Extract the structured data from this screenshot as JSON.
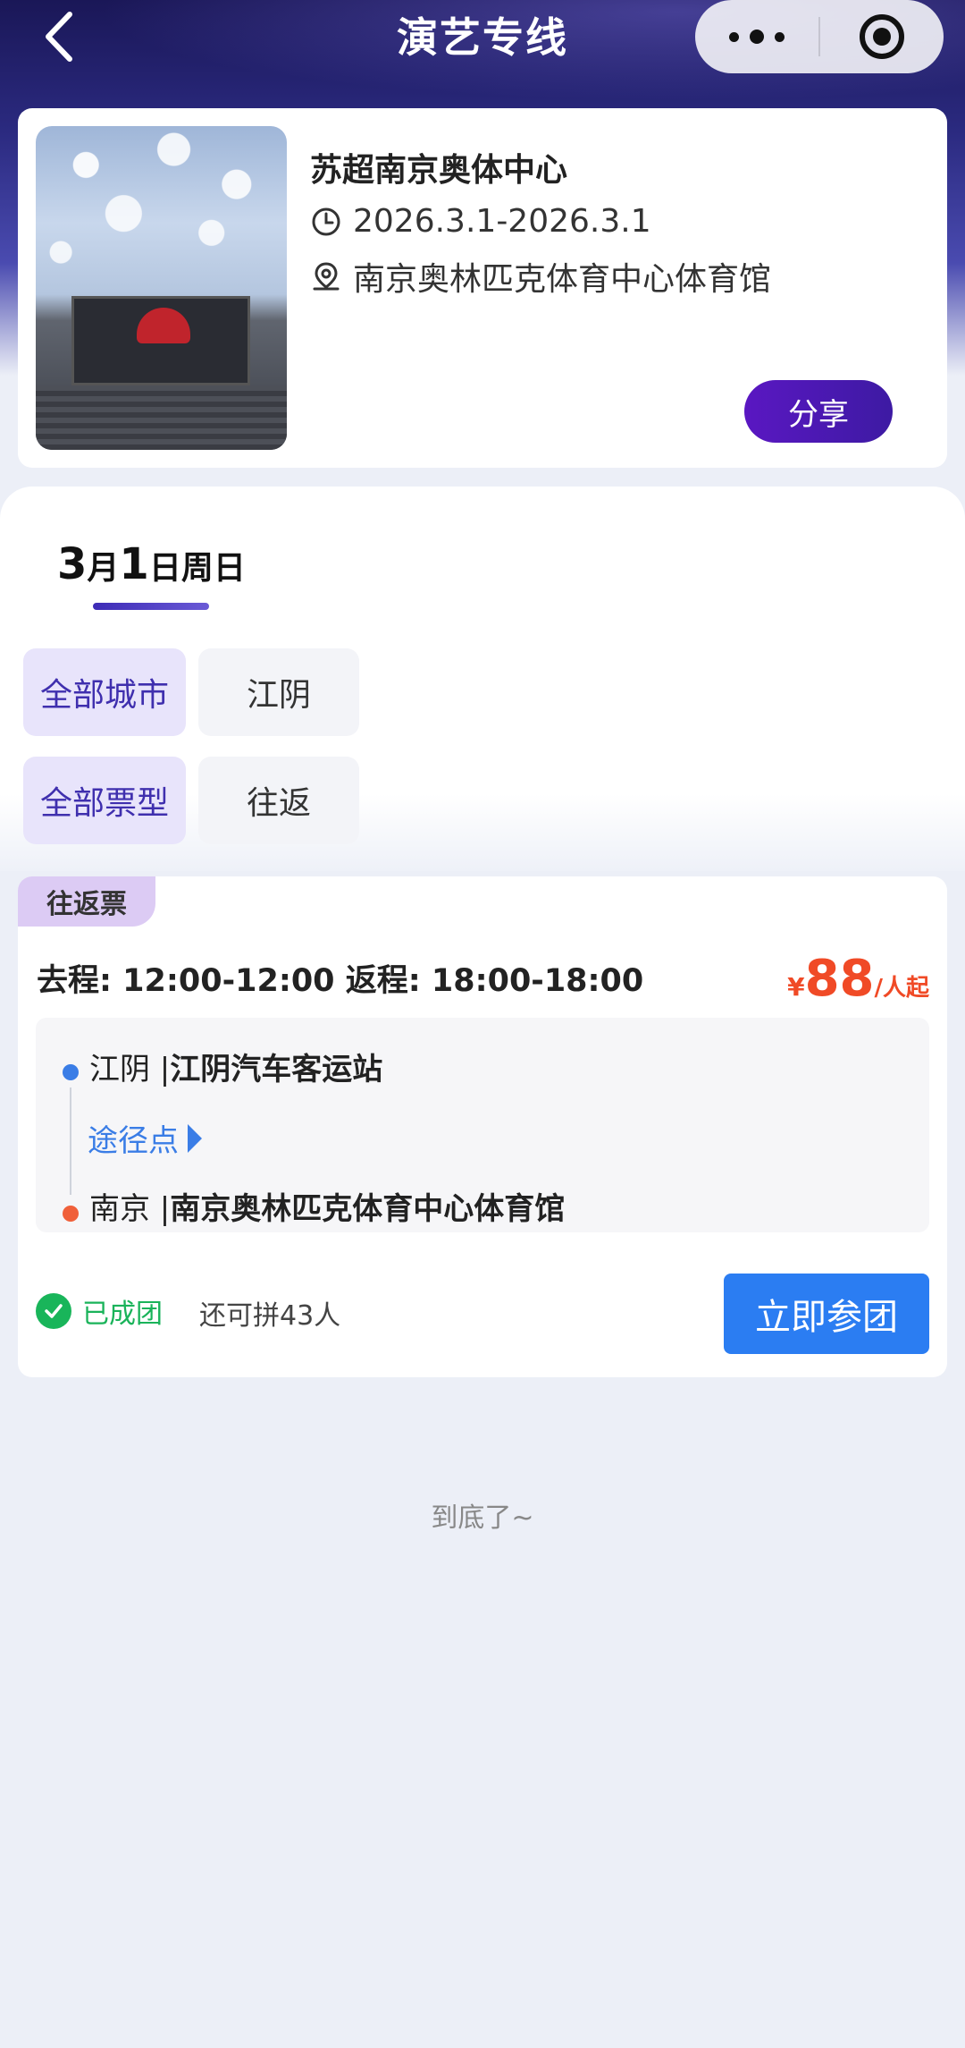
{
  "nav": {
    "title": "演艺专线"
  },
  "event": {
    "name": "苏超南京奥体中心",
    "date_range": "2026.3.1-2026.3.1",
    "venue": "南京奥林匹克体育中心体育馆",
    "share_label": "分享"
  },
  "date_tab": {
    "month": "3",
    "month_suffix": "月",
    "day": "1",
    "day_suffix": "日周日"
  },
  "filters": {
    "city_all": "全部城市",
    "city_option": "江阴",
    "type_all": "全部票型",
    "type_option": "往返"
  },
  "trip": {
    "tag": "往返票",
    "times": "去程: 12:00-12:00 返程: 18:00-18:00",
    "price_currency": "¥",
    "price_value": "88",
    "price_unit": "/人起",
    "from_city": "江阴 |",
    "from_station": "江阴汽车客运站",
    "via_label": "途径点",
    "to_city": "南京 |",
    "to_station": "南京奥林匹克体育中心体育馆",
    "status": "已成团",
    "remaining": "还可拼43人",
    "join_label": "立即参团"
  },
  "footer": {
    "end_text": "到底了~"
  },
  "colors": {
    "accent_purple": "#3f2fae",
    "price_red": "#f04a26",
    "action_blue": "#2b7df2",
    "success_green": "#19b55a"
  }
}
